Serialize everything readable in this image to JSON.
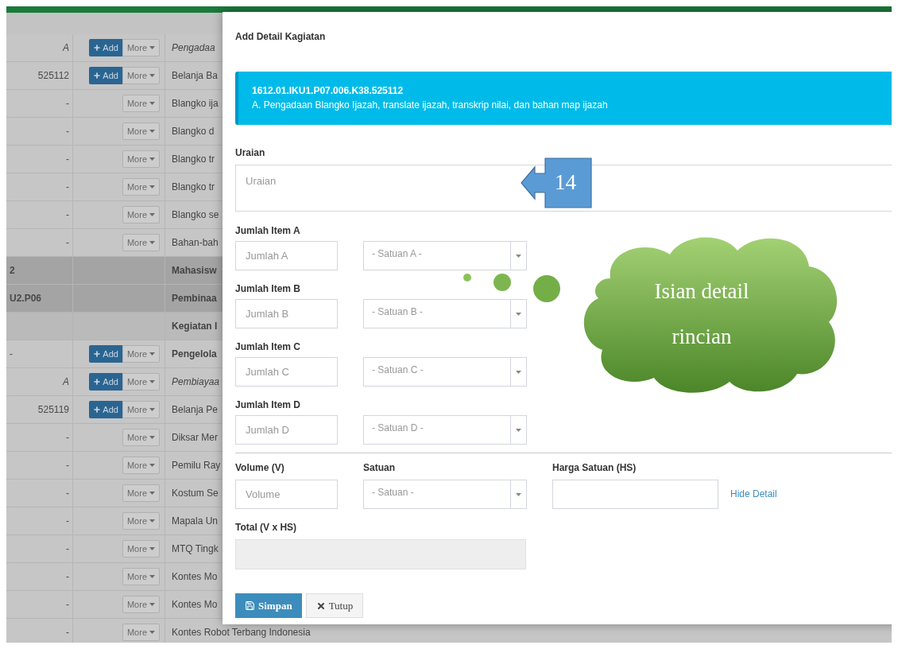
{
  "table": {
    "rows": [
      {
        "kind": "header",
        "code": "A",
        "text": "Pengadaa",
        "add": "Add",
        "more": "More"
      },
      {
        "kind": "account",
        "code": "525112",
        "text": "Belanja Ba",
        "add": "Add",
        "more": "More"
      },
      {
        "kind": "detail",
        "code": "-",
        "text": "Blangko ija",
        "more": "More"
      },
      {
        "kind": "detail",
        "code": "-",
        "text": "Blangko d",
        "more": "More"
      },
      {
        "kind": "detail",
        "code": "-",
        "text": "Blangko tr",
        "more": "More"
      },
      {
        "kind": "detail",
        "code": "-",
        "text": "Blangko tr",
        "more": "More"
      },
      {
        "kind": "detail",
        "code": "-",
        "text": "Blangko se",
        "more": "More"
      },
      {
        "kind": "detail",
        "code": "-",
        "text": "Bahan-bah",
        "more": "More"
      },
      {
        "kind": "group",
        "code": "2",
        "text": "Mahasisw"
      },
      {
        "kind": "group",
        "code": "U2.P06",
        "text": "Pembinaa"
      },
      {
        "kind": "subgroup",
        "text": "Kegiatan I"
      },
      {
        "kind": "program",
        "code": "-",
        "text": "Pengelola",
        "add": "Add",
        "more": "More"
      },
      {
        "kind": "header",
        "code": "A",
        "text": "Pembiayaa",
        "add": "Add",
        "more": "More"
      },
      {
        "kind": "account",
        "code": "525119",
        "text": "Belanja Pe",
        "add": "Add",
        "more": "More"
      },
      {
        "kind": "detail",
        "code": "-",
        "text": "Diksar Mer",
        "more": "More"
      },
      {
        "kind": "detail",
        "code": "-",
        "text": "Pemilu Ray",
        "more": "More"
      },
      {
        "kind": "detail",
        "code": "-",
        "text": "Kostum Se",
        "more": "More"
      },
      {
        "kind": "detail",
        "code": "-",
        "text": "Mapala Un",
        "more": "More"
      },
      {
        "kind": "detail",
        "code": "-",
        "text": "MTQ Tingk",
        "more": "More"
      },
      {
        "kind": "detail",
        "code": "-",
        "text": "Kontes Mo",
        "more": "More"
      },
      {
        "kind": "detail",
        "code": "-",
        "text": "Kontes Mo",
        "more": "More"
      },
      {
        "kind": "detail",
        "code": "-",
        "text": "Kontes Robot Terbang Indonesia",
        "more": "More"
      }
    ]
  },
  "modal": {
    "title": "Add Detail Kagiatan",
    "info": {
      "code": "1612.01.IKU1.P07.006.K38.525112",
      "description": "A. Pengadaan Blangko Ijazah, translate ijazah, transkrip nilai, dan bahan map ijazah"
    },
    "uraian": {
      "label": "Uraian",
      "placeholder": "Uraian"
    },
    "items": [
      {
        "label": "Jumlah Item A",
        "placeholder": "Jumlah A",
        "unit_placeholder": "- Satuan A -"
      },
      {
        "label": "Jumlah Item B",
        "placeholder": "Jumlah B",
        "unit_placeholder": "- Satuan B -"
      },
      {
        "label": "Jumlah Item C",
        "placeholder": "Jumlah C",
        "unit_placeholder": "- Satuan C -"
      },
      {
        "label": "Jumlah Item D",
        "placeholder": "Jumlah D",
        "unit_placeholder": "- Satuan D -"
      }
    ],
    "volume": {
      "label": "Volume (V)",
      "placeholder": "Volume"
    },
    "unit": {
      "label": "Satuan",
      "placeholder": "- Satuan -"
    },
    "price": {
      "label": "Harga Satuan (HS)"
    },
    "hide_detail": "Hide Detail",
    "total": {
      "label": "Total (V x HS)"
    },
    "buttons": {
      "save": "Simpan",
      "close": "Tutup"
    }
  },
  "annotations": {
    "callout": "14",
    "cloud": "Isian detail rincian"
  }
}
